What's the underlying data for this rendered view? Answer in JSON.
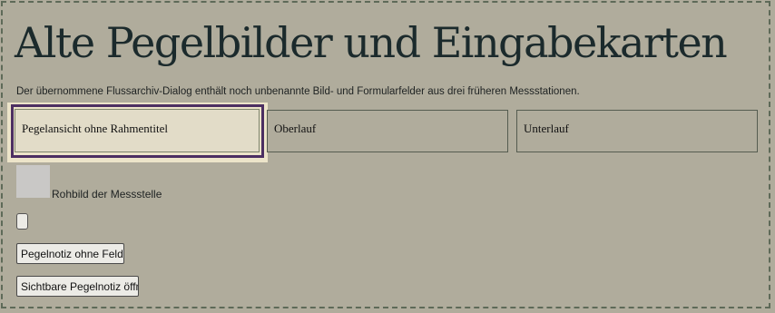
{
  "page": {
    "title": "Alte Pegelbilder und Eingabekarten",
    "description": "Der übernommene Flussarchiv-Dialog enthält noch unbenannte Bild- und Formularfelder aus drei früheren Messstationen."
  },
  "cards": [
    {
      "label": "Pegelansicht ohne Rahmentitel",
      "selected": true
    },
    {
      "label": "Oberlauf",
      "selected": false
    },
    {
      "label": "Unterlauf",
      "selected": false
    }
  ],
  "rohbild": {
    "label": "Rohbild der Messstelle"
  },
  "buttons": {
    "blank": "",
    "notiz": "Pegelnotiz ohne Feldbeze",
    "oeffnen": "Sichtbare Pegelnotiz öffnen"
  },
  "colors": {
    "background": "#b0ac9c",
    "selection_outline": "#4c2f62",
    "selection_highlight": "#ece4c9"
  }
}
